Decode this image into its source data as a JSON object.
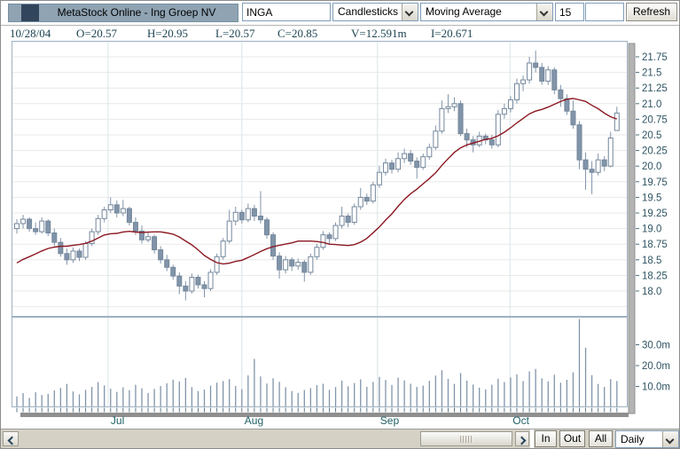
{
  "window_title": "MetaStock Online - Ing Groep NV",
  "controls": {
    "symbol": "INGA",
    "chart_type": "Candlesticks",
    "indicator": "Moving Average",
    "period": "15",
    "refresh_label": "Refresh"
  },
  "info_row": {
    "items": [
      "10/28/04",
      "O=20.57",
      "H=20.95",
      "L=20.57",
      "C=20.85",
      "V=12.591m",
      "I=20.671"
    ]
  },
  "bottom": {
    "in_label": "In",
    "out_label": "Out",
    "all_label": "All",
    "timeframe": "Daily"
  },
  "colors": {
    "titlebar": "#8fa3b3",
    "candle": "#8194a9",
    "ma_line": "#8c1822",
    "axis_text": "#2e5462",
    "month_text": "#1e5f66",
    "info_text": "#1d4552"
  },
  "chart_data": {
    "type": "candlestick+volume",
    "symbol": "INGA",
    "price_ylim": [
      17.6,
      22.0
    ],
    "grid": true,
    "y_ticks": [
      {
        "label": "21.75",
        "value": 21.75
      },
      {
        "label": "21.5",
        "value": 21.5
      },
      {
        "label": "21.25",
        "value": 21.25
      },
      {
        "label": "21.0",
        "value": 21.0
      },
      {
        "label": "20.75",
        "value": 20.75
      },
      {
        "label": "20.5",
        "value": 20.5
      },
      {
        "label": "20.25",
        "value": 20.25
      },
      {
        "label": "20.0",
        "value": 20.0
      },
      {
        "label": "19.75",
        "value": 19.75
      },
      {
        "label": "19.5",
        "value": 19.5
      },
      {
        "label": "19.25",
        "value": 19.25
      },
      {
        "label": "19.0",
        "value": 19.0
      },
      {
        "label": "18.75",
        "value": 18.75
      },
      {
        "label": "18.5",
        "value": 18.5
      },
      {
        "label": "18.25",
        "value": 18.25
      },
      {
        "label": "18.0",
        "value": 18.0
      }
    ],
    "volume_ticks": [
      {
        "label": "30.0m",
        "value": 30
      },
      {
        "label": "20.0m",
        "value": 20
      },
      {
        "label": "10.0m",
        "value": 10
      }
    ],
    "months": [
      {
        "label": "Jul",
        "i": 14.6
      },
      {
        "label": "Aug",
        "i": 36.0
      },
      {
        "label": "Sep",
        "i": 57.7
      },
      {
        "label": "Oct",
        "i": 78.9
      }
    ],
    "ma_period": 15,
    "ma_seed": [
      18.3,
      18.35,
      18.28,
      18.4,
      18.35,
      18.45,
      18.38,
      18.5,
      18.42,
      18.36,
      18.48,
      18.4,
      18.44,
      18.56
    ],
    "candles": [
      [
        19.0,
        19.15,
        18.92,
        19.08
      ],
      [
        19.08,
        19.22,
        19.0,
        19.15
      ],
      [
        19.15,
        19.18,
        18.95,
        19.0
      ],
      [
        19.0,
        19.1,
        18.9,
        18.95
      ],
      [
        18.95,
        19.18,
        18.92,
        19.12
      ],
      [
        19.12,
        19.15,
        18.88,
        18.93
      ],
      [
        18.93,
        19.0,
        18.72,
        18.78
      ],
      [
        18.78,
        18.85,
        18.55,
        18.6
      ],
      [
        18.6,
        18.68,
        18.42,
        18.5
      ],
      [
        18.5,
        18.7,
        18.45,
        18.64
      ],
      [
        18.64,
        18.68,
        18.48,
        18.54
      ],
      [
        18.54,
        18.8,
        18.5,
        18.76
      ],
      [
        18.76,
        19.0,
        18.72,
        18.95
      ],
      [
        18.95,
        19.22,
        18.9,
        19.16
      ],
      [
        19.16,
        19.35,
        19.1,
        19.3
      ],
      [
        19.3,
        19.5,
        19.25,
        19.38
      ],
      [
        19.38,
        19.45,
        19.18,
        19.25
      ],
      [
        19.25,
        19.46,
        19.2,
        19.32
      ],
      [
        19.32,
        19.35,
        19.05,
        19.1
      ],
      [
        19.1,
        19.18,
        18.9,
        18.96
      ],
      [
        18.96,
        19.05,
        18.76,
        18.82
      ],
      [
        18.82,
        18.95,
        18.78,
        18.87
      ],
      [
        18.87,
        18.9,
        18.6,
        18.66
      ],
      [
        18.66,
        18.72,
        18.44,
        18.5
      ],
      [
        18.5,
        18.58,
        18.32,
        18.38
      ],
      [
        18.38,
        18.42,
        18.18,
        18.24
      ],
      [
        18.24,
        18.3,
        17.95,
        18.08
      ],
      [
        18.08,
        18.16,
        17.85,
        18.0
      ],
      [
        18.0,
        18.28,
        17.96,
        18.22
      ],
      [
        18.22,
        18.26,
        18.04,
        18.1
      ],
      [
        18.1,
        18.16,
        17.9,
        18.04
      ],
      [
        18.04,
        18.35,
        18.0,
        18.3
      ],
      [
        18.3,
        18.6,
        18.26,
        18.55
      ],
      [
        18.55,
        18.85,
        18.5,
        18.8
      ],
      [
        18.8,
        19.3,
        18.76,
        19.12
      ],
      [
        19.12,
        19.35,
        19.05,
        19.26
      ],
      [
        19.26,
        19.3,
        19.08,
        19.14
      ],
      [
        19.14,
        19.4,
        19.1,
        19.32
      ],
      [
        19.32,
        19.38,
        19.12,
        19.2
      ],
      [
        19.2,
        19.6,
        19.08,
        19.14
      ],
      [
        19.14,
        19.18,
        18.84,
        18.9
      ],
      [
        18.9,
        18.94,
        18.5,
        18.56
      ],
      [
        18.56,
        18.62,
        18.2,
        18.34
      ],
      [
        18.34,
        18.56,
        18.28,
        18.5
      ],
      [
        18.5,
        18.54,
        18.32,
        18.4
      ],
      [
        18.4,
        18.52,
        18.34,
        18.46
      ],
      [
        18.46,
        18.5,
        18.15,
        18.3
      ],
      [
        18.3,
        18.6,
        18.26,
        18.55
      ],
      [
        18.55,
        18.76,
        18.5,
        18.7
      ],
      [
        18.7,
        18.96,
        18.66,
        18.9
      ],
      [
        18.9,
        18.94,
        18.74,
        18.84
      ],
      [
        18.84,
        19.1,
        18.8,
        19.05
      ],
      [
        19.05,
        19.35,
        19.0,
        19.2
      ],
      [
        19.2,
        19.24,
        19.02,
        19.1
      ],
      [
        19.1,
        19.4,
        19.06,
        19.35
      ],
      [
        19.35,
        19.65,
        19.3,
        19.5
      ],
      [
        19.5,
        19.56,
        19.38,
        19.44
      ],
      [
        19.44,
        19.75,
        19.4,
        19.7
      ],
      [
        19.7,
        20.0,
        19.65,
        19.9
      ],
      [
        19.9,
        20.12,
        19.85,
        20.05
      ],
      [
        20.05,
        20.1,
        19.88,
        19.95
      ],
      [
        19.95,
        20.22,
        19.9,
        20.12
      ],
      [
        20.12,
        20.28,
        20.05,
        20.2
      ],
      [
        20.2,
        20.26,
        20.02,
        20.08
      ],
      [
        20.08,
        20.14,
        19.8,
        19.98
      ],
      [
        19.98,
        20.2,
        19.94,
        20.15
      ],
      [
        20.15,
        20.36,
        20.1,
        20.3
      ],
      [
        20.3,
        20.65,
        20.26,
        20.56
      ],
      [
        20.56,
        21.05,
        20.52,
        20.92
      ],
      [
        20.92,
        21.15,
        20.85,
        20.95
      ],
      [
        20.95,
        21.1,
        20.88,
        21.0
      ],
      [
        21.0,
        21.05,
        20.48,
        20.52
      ],
      [
        20.52,
        20.6,
        20.3,
        20.42
      ],
      [
        20.42,
        20.48,
        20.22,
        20.34
      ],
      [
        20.34,
        20.55,
        20.3,
        20.48
      ],
      [
        20.48,
        20.52,
        20.35,
        20.42
      ],
      [
        20.42,
        20.5,
        20.28,
        20.34
      ],
      [
        20.34,
        20.9,
        20.3,
        20.83
      ],
      [
        20.83,
        21.0,
        20.76,
        20.92
      ],
      [
        20.92,
        21.12,
        20.86,
        21.06
      ],
      [
        21.06,
        21.4,
        21.0,
        21.32
      ],
      [
        21.32,
        21.45,
        21.2,
        21.38
      ],
      [
        21.38,
        21.75,
        21.32,
        21.65
      ],
      [
        21.65,
        21.85,
        21.5,
        21.58
      ],
      [
        21.58,
        21.65,
        21.3,
        21.36
      ],
      [
        21.36,
        21.6,
        21.3,
        21.54
      ],
      [
        21.54,
        21.58,
        21.15,
        21.22
      ],
      [
        21.22,
        21.3,
        20.95,
        21.08
      ],
      [
        21.08,
        21.15,
        20.82,
        20.88
      ],
      [
        20.88,
        21.05,
        20.6,
        20.66
      ],
      [
        20.66,
        20.72,
        19.95,
        20.1
      ],
      [
        20.1,
        20.22,
        19.62,
        19.95
      ],
      [
        19.95,
        20.08,
        19.55,
        19.9
      ],
      [
        19.9,
        20.2,
        19.85,
        20.1
      ],
      [
        20.1,
        20.16,
        19.92,
        20.0
      ],
      [
        20.0,
        20.55,
        19.98,
        20.45
      ],
      [
        20.57,
        20.95,
        20.57,
        20.85
      ]
    ],
    "volumes": [
      5.2,
      6.8,
      4.5,
      7.2,
      5.9,
      6.4,
      8.1,
      9.3,
      11.2,
      7.6,
      6.2,
      8.4,
      9.8,
      12.1,
      10.5,
      8.9,
      7.4,
      9.6,
      8.2,
      10.8,
      9.1,
      6.8,
      8.8,
      10.2,
      11.5,
      13.2,
      12.4,
      14.1,
      9.7,
      7.8,
      8.5,
      10.4,
      11.8,
      12.6,
      13.5,
      10.2,
      8.7,
      15.3,
      23.2,
      14.8,
      11.4,
      13.9,
      12.2,
      9.6,
      7.8,
      6.9,
      8.3,
      9.2,
      10.6,
      11.3,
      8.4,
      9.7,
      12.8,
      10.1,
      11.6,
      13.4,
      9.8,
      12.2,
      14.6,
      13.1,
      10.7,
      14.2,
      12.9,
      11.3,
      9.8,
      10.4,
      12.7,
      15.2,
      17.8,
      13.6,
      11.2,
      16.4,
      12.8,
      10.9,
      9.4,
      8.6,
      10.8,
      13.7,
      12.1,
      14.3,
      15.8,
      12.6,
      17.2,
      18.4,
      13.9,
      12.4,
      15.6,
      11.8,
      13.2,
      16.8,
      42.3,
      28.6,
      15.4,
      11.2,
      9.8,
      13.5,
      12.591
    ]
  }
}
